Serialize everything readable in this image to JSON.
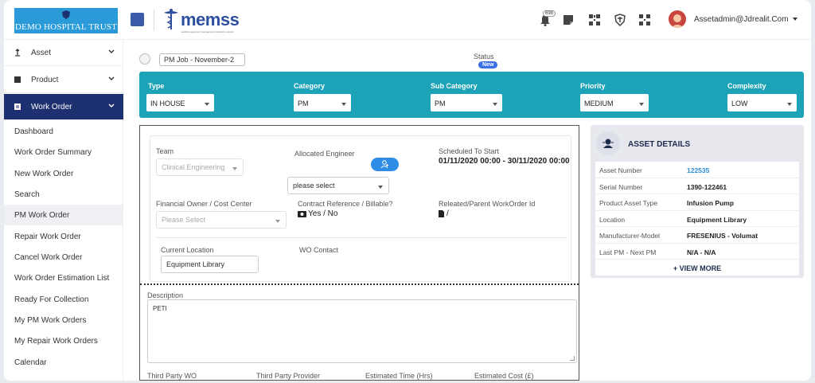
{
  "header": {
    "hospital_name": "DEMO HOSPITAL TRUST",
    "app_logo": "memss",
    "app_tagline": "medical equipment management software solution",
    "notification_count": "698",
    "user_email": "Assetadmin@Jdrealit.Com",
    "icons": [
      "menu-square-icon",
      "bell-icon",
      "note-icon",
      "qr-icon",
      "crest-icon",
      "qr-icon",
      "avatar",
      "caret-down-icon"
    ]
  },
  "sidebar": {
    "groups": [
      {
        "label": "Asset",
        "icon": "asset-icon"
      },
      {
        "label": "Product",
        "icon": "product-icon"
      },
      {
        "label": "Work Order",
        "icon": "work-order-icon"
      }
    ],
    "items": [
      {
        "label": "Dashboard"
      },
      {
        "label": "Work Order Summary"
      },
      {
        "label": "New Work Order"
      },
      {
        "label": "Search"
      },
      {
        "label": "PM Work Order"
      },
      {
        "label": "Repair Work Order"
      },
      {
        "label": "Cancel Work Order"
      },
      {
        "label": "Work Order Estimation List"
      },
      {
        "label": "Ready For Collection"
      },
      {
        "label": "My PM Work Orders"
      },
      {
        "label": "My Repair Work Orders"
      },
      {
        "label": "Calendar"
      }
    ],
    "active_color": "#1d3170"
  },
  "main": {
    "job_select": "PM Job - November-2",
    "status_label": "Status",
    "status_value": "New",
    "filters": {
      "type_label": "Type",
      "type_value": "IN HOUSE",
      "category_label": "Category",
      "category_value": "PM",
      "subcategory_label": "Sub Category",
      "subcategory_value": "PM",
      "priority_label": "Priority",
      "priority_value": "MEDIUM",
      "complexity_label": "Complexity",
      "complexity_value": "LOW",
      "bar_color": "#1ca3b7"
    },
    "form": {
      "team_label": "Team",
      "team_value": "Clinical Engineering",
      "engineer_label": "Allocated Engineer",
      "engineer_placeholder": "please select",
      "scheduled_label": "Scheduled To Start",
      "scheduled_value": "01/11/2020 00:00 - 30/11/2020 00:00",
      "owner_label": "Financial Owner / Cost Center",
      "owner_placeholder": "Please Select",
      "contract_label": "Contract Reference / Billable?",
      "contract_value": "Yes / No",
      "related_label": "Releated/Parent WorkOrder Id",
      "related_value": "/",
      "location_label": "Current Location",
      "location_value": "Equipment Library",
      "wo_contact_label": "WO Contact",
      "description_label": "Description",
      "description_value": "PETI",
      "bottom_labels": [
        "Third Party WO",
        "Third Party Provider",
        "Estimated Time (Hrs)",
        "Estimated Cost (£)"
      ]
    },
    "asset": {
      "title": "ASSET DETAILS",
      "rows": [
        {
          "k": "Asset Number",
          "v": "122535"
        },
        {
          "k": "Serial Number",
          "v": "1390-122461"
        },
        {
          "k": "Product Asset Type",
          "v": "Infusion Pump"
        },
        {
          "k": "Location",
          "v": "Equipment Library"
        },
        {
          "k": "Manufacturer-Model",
          "v": "FRESENIUS - Volumat"
        },
        {
          "k": "Last PM - Next PM",
          "v": "N/A - N/A"
        }
      ],
      "view_more": "+ VIEW MORE"
    }
  }
}
